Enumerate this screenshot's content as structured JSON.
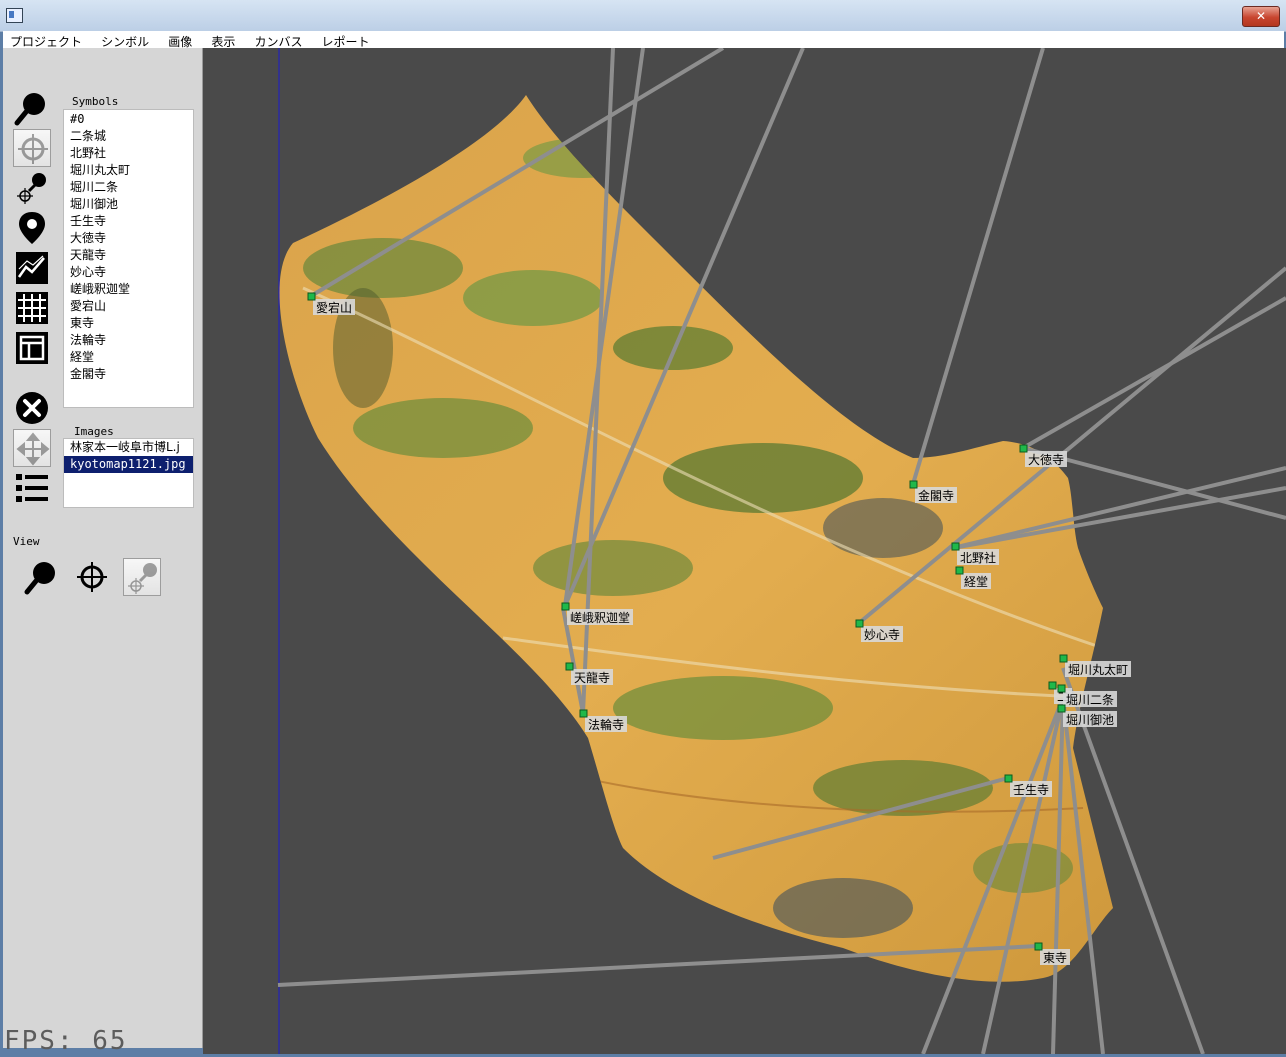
{
  "menu": [
    "プロジェクト",
    "シンボル",
    "画像",
    "表示",
    "カンバス",
    "レポート"
  ],
  "titlebar": {
    "close_glyph": "✕"
  },
  "symbols": {
    "label": "Symbols",
    "items": [
      "#0",
      "二条城",
      "北野社",
      "堀川丸太町",
      "堀川二条",
      "堀川御池",
      "壬生寺",
      "大徳寺",
      "天龍寺",
      "妙心寺",
      "嵯峨釈迦堂",
      "愛宕山",
      "東寺",
      "法輪寺",
      "経堂",
      "金閣寺"
    ]
  },
  "images": {
    "label": "Images",
    "items": [
      "林家本一岐阜市博L.j",
      "kyotomap1121.jpg"
    ],
    "selected_index": 1
  },
  "view": {
    "label": "View"
  },
  "fps": "FPS: 65",
  "map_labels": [
    {
      "id": "atago",
      "text": "愛宕山"
    },
    {
      "id": "daitokuji",
      "text": "大徳寺"
    },
    {
      "id": "kinkakuji",
      "text": "金閣寺"
    },
    {
      "id": "kitanosha",
      "text": "北野社"
    },
    {
      "id": "kyodo",
      "text": "経堂"
    },
    {
      "id": "sagashakado",
      "text": "嵯峨釈迦堂"
    },
    {
      "id": "myoshinji",
      "text": "妙心寺"
    },
    {
      "id": "tenryuji",
      "text": "天龍寺"
    },
    {
      "id": "horinji",
      "text": "法輪寺"
    },
    {
      "id": "horikawamarutamachi",
      "text": "堀川丸太町"
    },
    {
      "id": "nijo",
      "text": "二"
    },
    {
      "id": "horikawanijo",
      "text": "堀川二条"
    },
    {
      "id": "horikawaoike",
      "text": "堀川御池"
    },
    {
      "id": "mibudera",
      "text": "壬生寺"
    },
    {
      "id": "toji",
      "text": "東寺"
    }
  ],
  "colors": {
    "viewport_bg": "#4a4a4a",
    "line": "#8e8e8e",
    "marker": "#1fb84a",
    "selected": "#0d1f6e"
  }
}
